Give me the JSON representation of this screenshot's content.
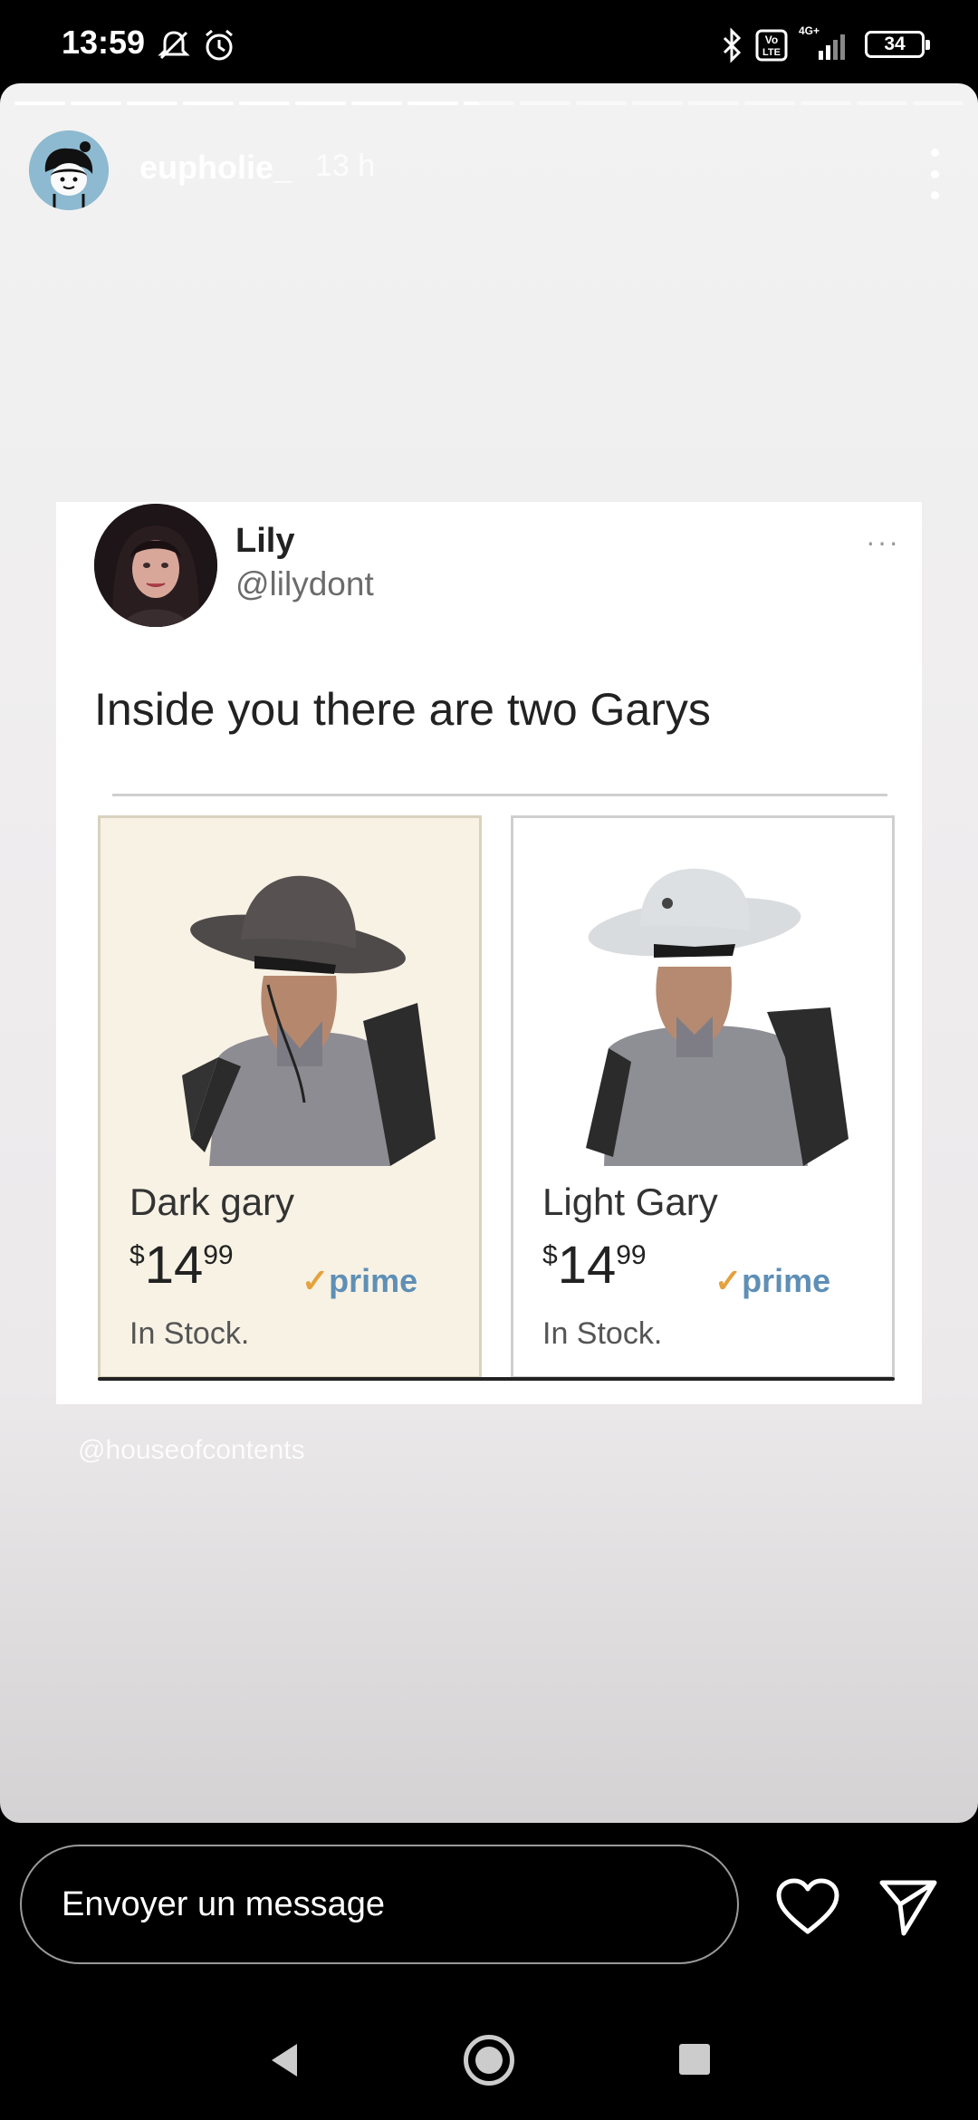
{
  "status_bar": {
    "time": "13:59",
    "battery": "34",
    "icons": [
      "mute-notification-icon",
      "alarm-icon",
      "bluetooth-icon",
      "volte-icon",
      "signal-4g-icon"
    ],
    "network_label": "4G+",
    "volte_label": "Vo LTE"
  },
  "story": {
    "username": "eupholie_",
    "time_ago": "13 h",
    "progress": {
      "segments": 17,
      "completed": 8,
      "current_fraction": 0.3
    },
    "watermark": "@houseofcontents"
  },
  "tweet": {
    "name": "Lily",
    "handle": "@lilydont",
    "more": "···",
    "text": "Inside you there are two Garys",
    "products": [
      {
        "name": "Dark gary",
        "currency": "$",
        "dollars": "14",
        "cents": "99",
        "prime_label": "prime",
        "stock": "In Stock.",
        "hat_color": "#55504f"
      },
      {
        "name": "Light Gary",
        "currency": "$",
        "dollars": "14",
        "cents": "99",
        "prime_label": "prime",
        "stock": "In Stock.",
        "hat_color": "#cfd3d6"
      }
    ]
  },
  "reply": {
    "placeholder": "Envoyer un message",
    "icons": [
      "heart-icon",
      "send-icon"
    ]
  },
  "nav": {
    "icons": [
      "back-icon",
      "home-icon",
      "recent-apps-icon"
    ]
  }
}
